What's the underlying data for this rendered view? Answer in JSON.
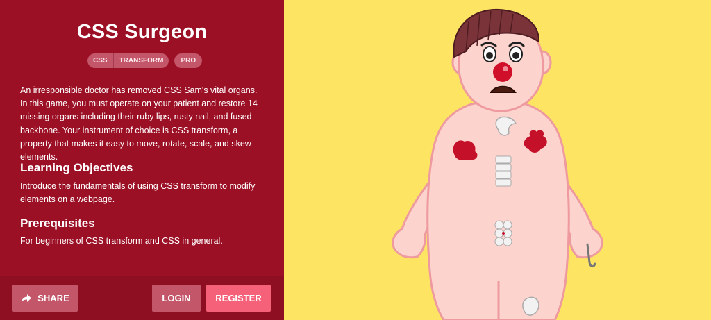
{
  "app": {
    "title": "CSS Surgeon",
    "tags": [
      "CSS",
      "TRANSFORM"
    ],
    "level": "PRO"
  },
  "description": "An irresponsible doctor has removed CSS Sam's vital organs. In this game, you must operate on your patient and restore 14 missing organs including their ruby lips, rusty nail, and fused backbone. Your instrument of choice is CSS transform, a property that makes it easy to move, rotate, scale, and skew elements.",
  "objectives": {
    "heading": "Learning Objectives",
    "text": "Introduce the fundamentals of using CSS transform to modify elements on a webpage."
  },
  "prerequisites": {
    "heading": "Prerequisites",
    "text": "For beginners of CSS transform and CSS in general."
  },
  "footer": {
    "share_label": "SHARE",
    "login_label": "LOGIN",
    "register_label": "REGISTER"
  },
  "colors": {
    "panel": "#9b1025",
    "footer": "#8d0f21",
    "stage": "#fde462",
    "skin": "#fcd3cd",
    "skin_outline": "#ee9a9e",
    "organ": "#c5102a",
    "hair": "#7a3338",
    "register": "#f46178",
    "button": "#c4566a"
  },
  "icons": [
    "share-icon"
  ]
}
